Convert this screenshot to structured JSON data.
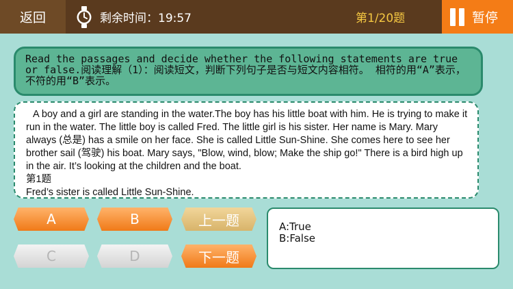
{
  "header": {
    "back_label": "返回",
    "timer_label": "剩余时间：",
    "timer_value": "19:57",
    "progress": "第1/20题",
    "pause_label": "暂停"
  },
  "instruction": "Read the passages and decide whether the following statements are true or false.阅读理解（1）：阅读短文，判断下列句子是否与短文内容相符。 相符的用“A”表示，不符的用“B”表示。",
  "passage": {
    "body": "A boy and a girl are standing in the water.The boy has his little boat with him.  He is trying to make it run in the water.  The little boy is called Fred.  The little girl is his sister.  Her name is Mary.  Mary always (总是) has a smile on her face.  She is called Little Sun-Shine.  She comes here to see her brother sail (驾驶) his boat.   Mary says, \"Blow, wind, blow; Make the ship go!\"  There is a bird high up in the air.   It’s looking at the children and the boat.",
    "question_number": "第1题",
    "question": "Fred’s sister is called Little Sun-Shine."
  },
  "choices": {
    "a": "A",
    "b": "B",
    "c": "C",
    "d": "D",
    "prev": "上一题",
    "next": "下一题"
  },
  "answer_options": [
    "A:True",
    "B:False"
  ],
  "colors": {
    "background": "#a9ddd6",
    "topbar": "#5a3a1e",
    "accent": "#f47c16",
    "green": "#5db594"
  }
}
